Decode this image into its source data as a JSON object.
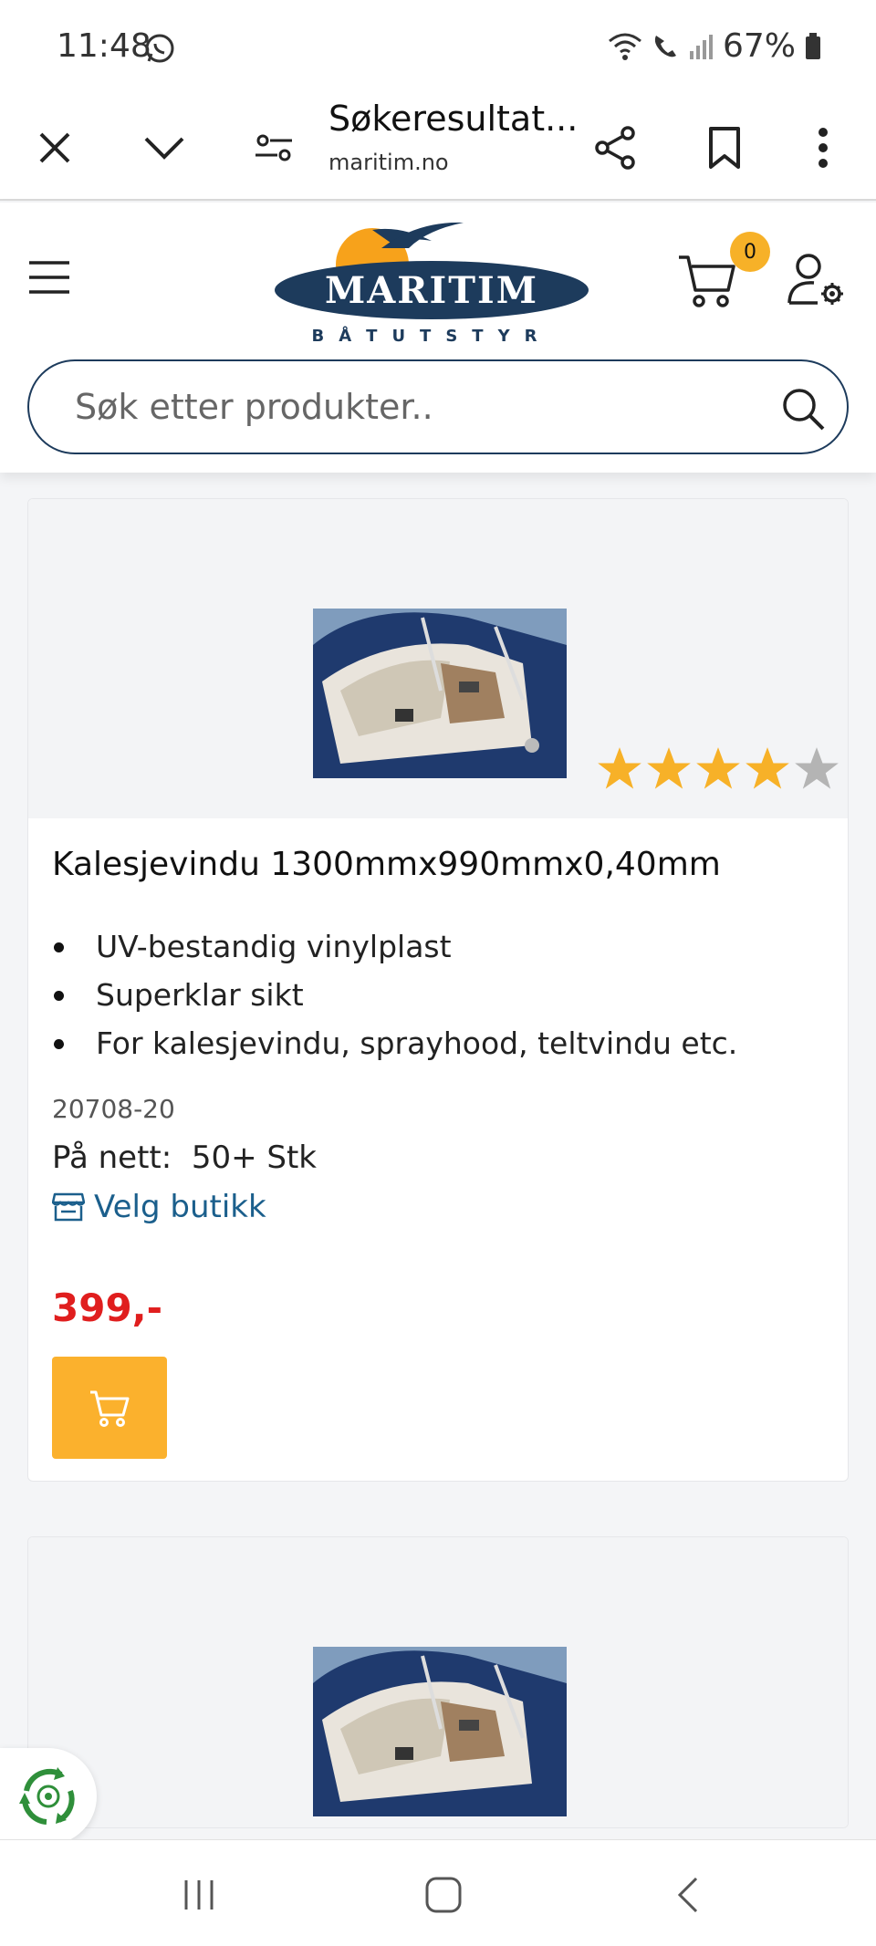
{
  "status_bar": {
    "time": "11:48",
    "battery": "67%"
  },
  "browser": {
    "page_title": "Søkeresultat...",
    "url": "maritim.no",
    "icons": [
      "close-icon",
      "chevron-down-icon",
      "page-settings-icon",
      "share-icon",
      "bookmark-icon",
      "more-vert-icon"
    ]
  },
  "header": {
    "logo_text": "MARITIM",
    "logo_subtext": "BÅTUTSTYR",
    "cart_count": "0",
    "search": {
      "placeholder": "Søk etter produkter.."
    }
  },
  "products": [
    {
      "image_alt": "Kalesje på båt",
      "rating": 4,
      "rating_max": 5,
      "title": "Kalesjevindu 1300mmx990mmx0,40mm",
      "features": [
        "UV-bestandig vinylplast",
        "Superklar sikt",
        "For kalesjevindu, sprayhood, teltvindu etc."
      ],
      "sku": "20708-20",
      "stock": "På nett:  50+ Stk",
      "store_link": "Velg butikk",
      "price": "399,-"
    },
    {
      "image_alt": "Kalesje på båt"
    }
  ],
  "colors": {
    "brand_navy": "#1d3b5c",
    "accent_orange": "#fbb12d",
    "price_red": "#e01e1e",
    "link_blue": "#1b5f8c"
  }
}
